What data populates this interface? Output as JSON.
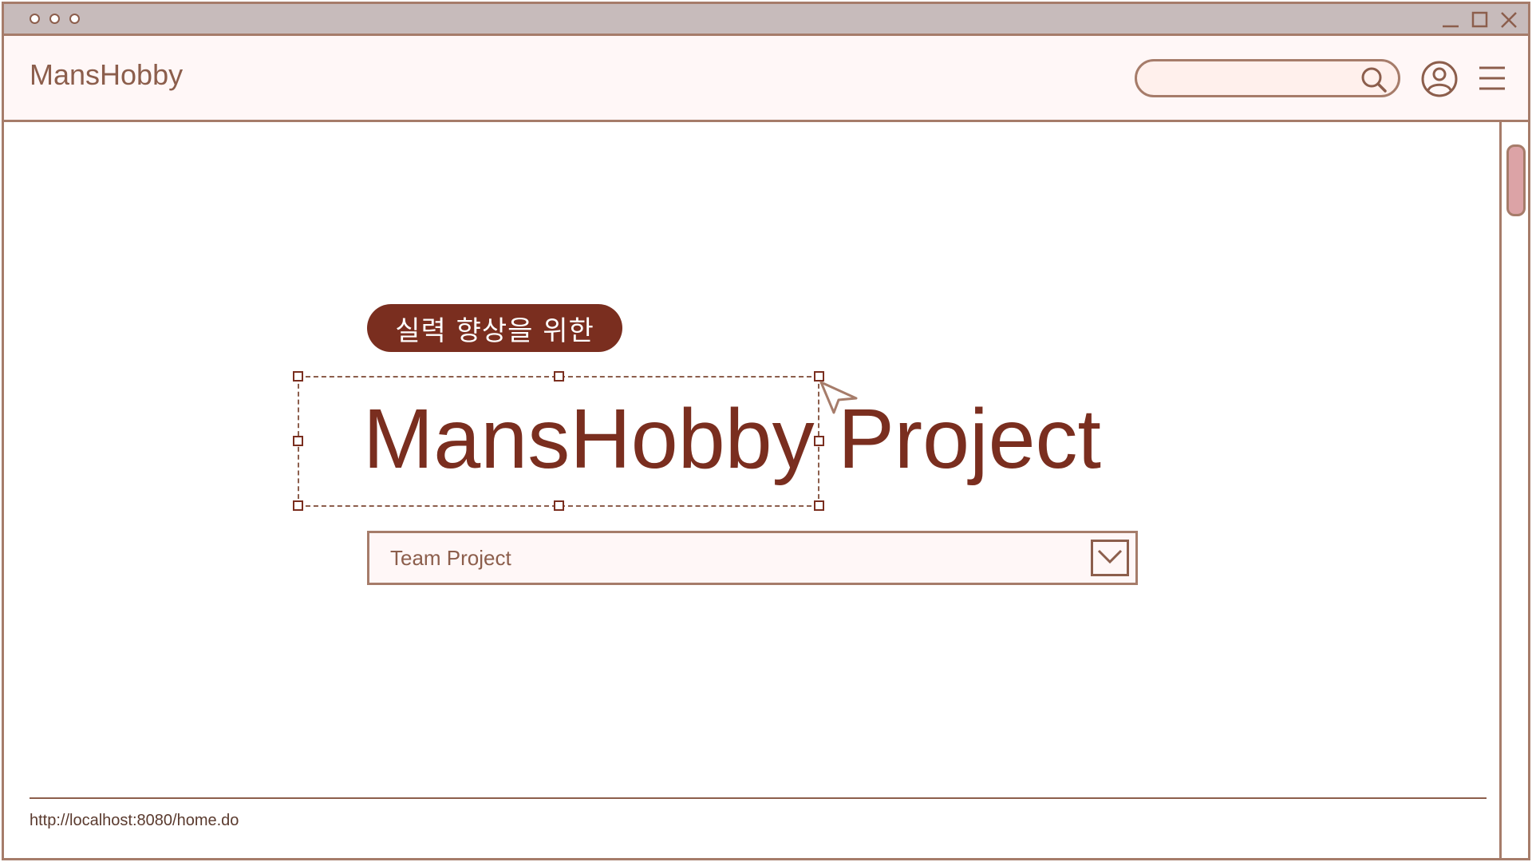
{
  "window": {
    "controls": [
      "minimize-icon",
      "maximize-icon",
      "close-icon"
    ]
  },
  "navbar": {
    "brand": "MansHobby",
    "search": {
      "value": "",
      "placeholder": ""
    },
    "icons": [
      "search-icon",
      "user-icon",
      "menu-icon"
    ]
  },
  "hero": {
    "tagline": "실력 향상을 위한",
    "title_selected": "MansHobby",
    "title_rest": "Project",
    "dropdown": {
      "selected": "Team Project"
    }
  },
  "footer": {
    "url": "http://localhost:8080/home.do"
  },
  "colors": {
    "accent": "#7a2e1f",
    "border": "#a67c6a",
    "titlebar": "#c7bbbb",
    "navbar_bg": "#fff7f7",
    "scroll_thumb": "#dca3a6"
  }
}
